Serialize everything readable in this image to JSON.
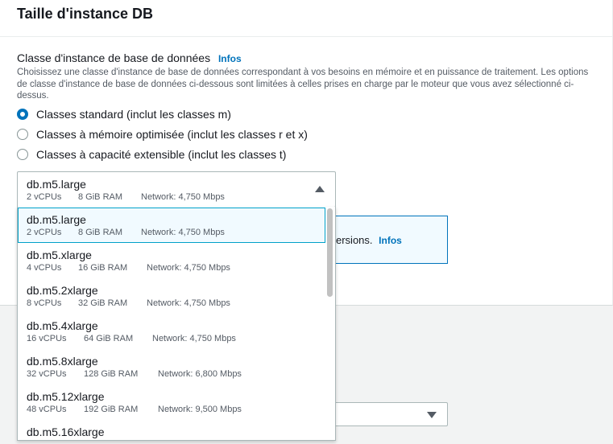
{
  "panel": {
    "title": "Taille d'instance DB",
    "field_label": "Classe d'instance de base de données",
    "info_link": "Infos",
    "description": "Choisissez une classe d'instance de base de données correspondant à vos besoins en mémoire et en puissance de traitement. Les options de classe d'instance de base de données ci-dessous sont limitées à celles prises en charge par le moteur que vous avez sélectionné ci-dessus.",
    "radios": [
      {
        "label": "Classes standard (inclut les classes m)",
        "checked": true
      },
      {
        "label": "Classes à mémoire optimisée (inclut les classes r et x)",
        "checked": false
      },
      {
        "label": "Classes à capacité extensible (inclut les classes t)",
        "checked": false
      }
    ]
  },
  "select": {
    "value": "db.m5.large",
    "meta": {
      "vcpu": "2 vCPUs",
      "ram": "8 GiB RAM",
      "network": "Network: 4,750 Mbps"
    }
  },
  "info_box": {
    "text": "ersions.",
    "link": "Infos"
  },
  "dropdown": {
    "options": [
      {
        "name": "db.m5.large",
        "vcpu": "2 vCPUs",
        "ram": "8 GiB RAM",
        "network": "Network: 4,750 Mbps"
      },
      {
        "name": "db.m5.xlarge",
        "vcpu": "4 vCPUs",
        "ram": "16 GiB RAM",
        "network": "Network: 4,750 Mbps"
      },
      {
        "name": "db.m5.2xlarge",
        "vcpu": "8 vCPUs",
        "ram": "32 GiB RAM",
        "network": "Network: 4,750 Mbps"
      },
      {
        "name": "db.m5.4xlarge",
        "vcpu": "16 vCPUs",
        "ram": "64 GiB RAM",
        "network": "Network: 4,750 Mbps"
      },
      {
        "name": "db.m5.8xlarge",
        "vcpu": "32 vCPUs",
        "ram": "128 GiB RAM",
        "network": "Network: 6,800 Mbps"
      },
      {
        "name": "db.m5.12xlarge",
        "vcpu": "48 vCPUs",
        "ram": "192 GiB RAM",
        "network": "Network: 9,500 Mbps"
      },
      {
        "name": "db.m5.16xlarge",
        "vcpu": "",
        "ram": "",
        "network": ""
      }
    ]
  }
}
